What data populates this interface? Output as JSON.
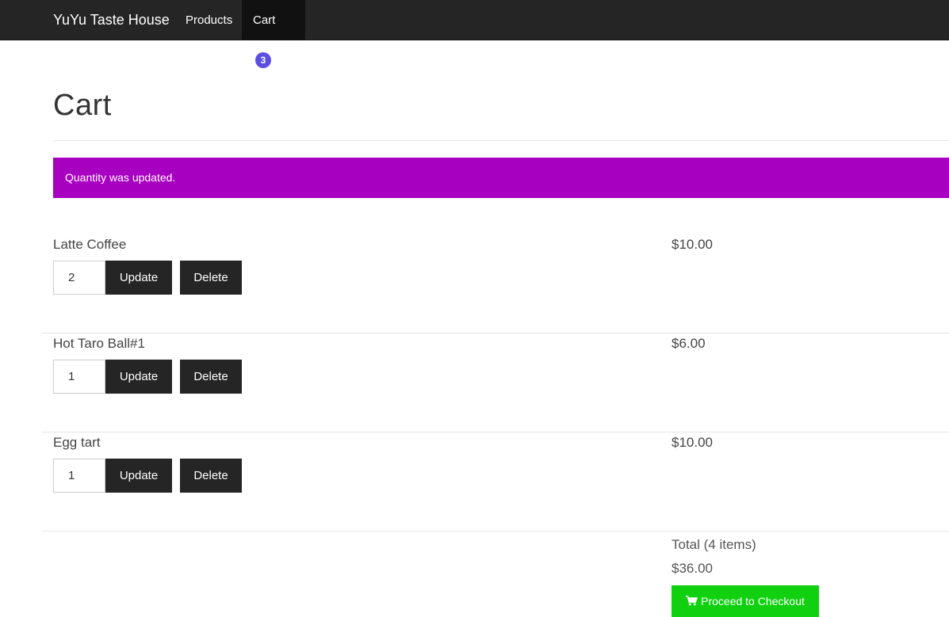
{
  "navbar": {
    "brand": "YuYu Taste House",
    "products_label": "Products",
    "cart_label": "Cart",
    "cart_count": "3"
  },
  "page": {
    "title": "Cart"
  },
  "alert": {
    "message": "Quantity was updated.",
    "color": "#a800c0"
  },
  "items": [
    {
      "name": "Latte Coffee",
      "quantity": "2",
      "price": "$10.00",
      "update_label": "Update",
      "delete_label": "Delete"
    },
    {
      "name": "Hot Taro Ball#1",
      "quantity": "1",
      "price": "$6.00",
      "update_label": "Update",
      "delete_label": "Delete"
    },
    {
      "name": "Egg tart",
      "quantity": "1",
      "price": "$10.00",
      "update_label": "Update",
      "delete_label": "Delete"
    }
  ],
  "summary": {
    "total_label": "Total (4 items)",
    "total_amount": "$36.00",
    "checkout_label": "Proceed to Checkout",
    "checkout_icon": "shopping-cart-icon",
    "checkout_color": "#10d010"
  }
}
